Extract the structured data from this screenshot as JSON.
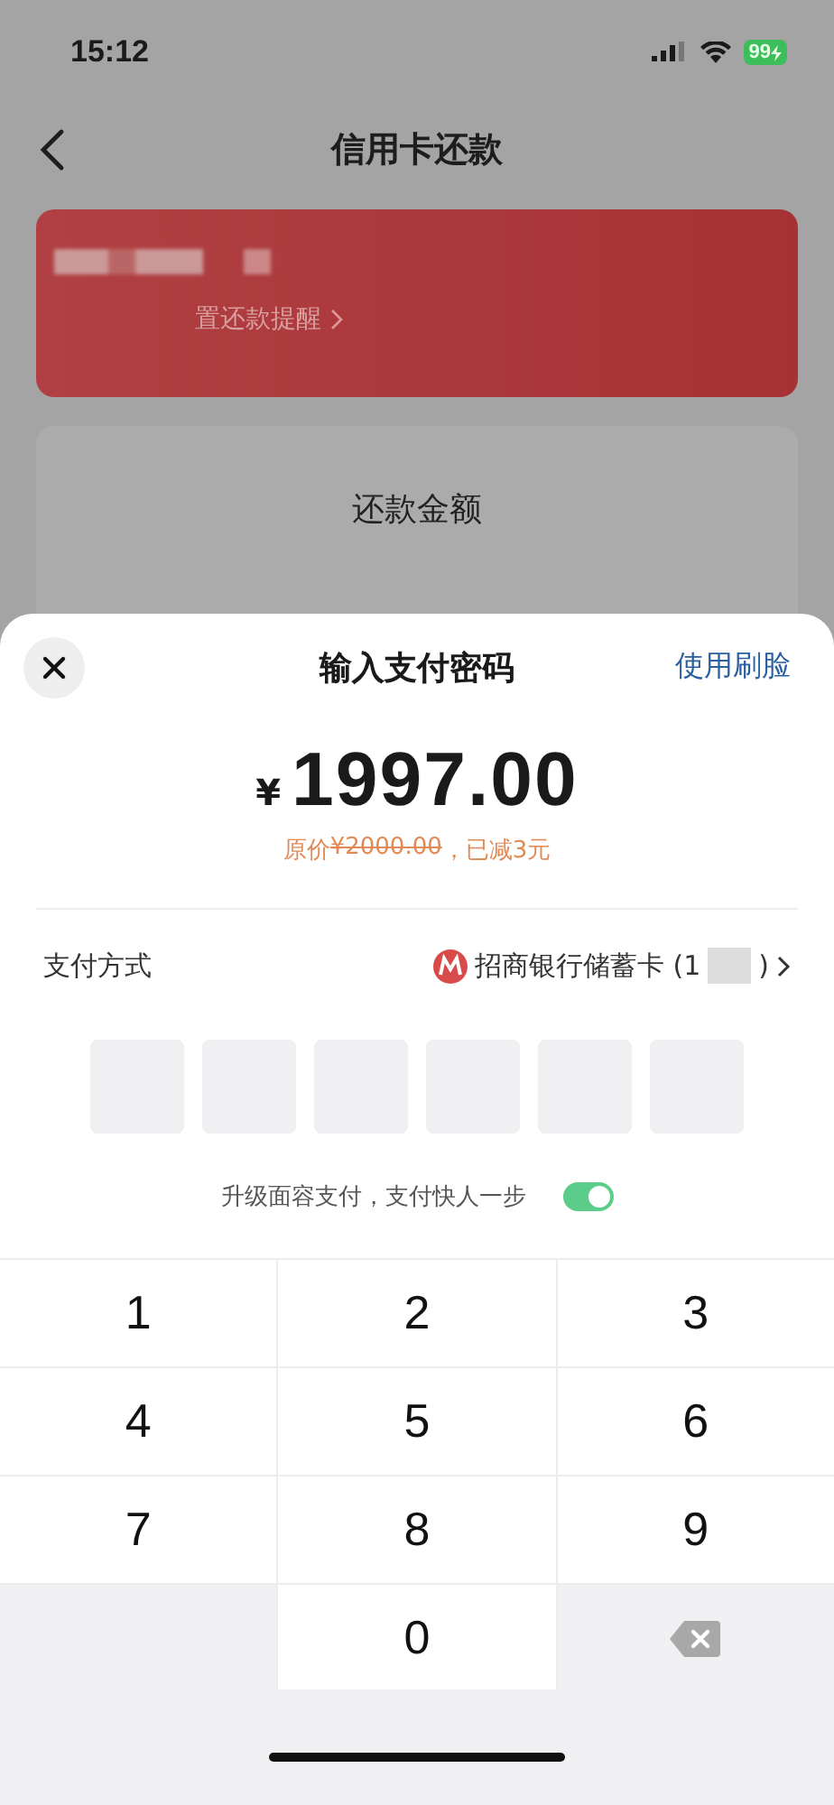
{
  "status_bar": {
    "time": "15:12",
    "battery": "99"
  },
  "nav": {
    "title": "信用卡还款"
  },
  "card": {
    "reminder_link": "置还款提醒"
  },
  "amount_card": {
    "label": "还款金额"
  },
  "sheet": {
    "title": "输入支付密码",
    "face_link": "使用刷脸",
    "currency": "¥",
    "amount": "1997.00",
    "original_label": "原价",
    "original_price": "¥2000.00",
    "discount": "，已减3元",
    "method_label": "支付方式",
    "method_value": "招商银行储蓄卡 (1",
    "method_close": ")",
    "pin_boxes": [
      {
        "filled": false
      },
      {
        "filled": false
      },
      {
        "filled": false
      },
      {
        "filled": false
      },
      {
        "filled": false
      },
      {
        "filled": false
      }
    ],
    "face_upgrade": {
      "text": "升级面容支付，支付快人一步",
      "on": true
    }
  },
  "keypad": [
    {
      "kind": "digit",
      "label": "1"
    },
    {
      "kind": "digit",
      "label": "2"
    },
    {
      "kind": "digit",
      "label": "3"
    },
    {
      "kind": "digit",
      "label": "4"
    },
    {
      "kind": "digit",
      "label": "5"
    },
    {
      "kind": "digit",
      "label": "6"
    },
    {
      "kind": "digit",
      "label": "7"
    },
    {
      "kind": "digit",
      "label": "8"
    },
    {
      "kind": "digit",
      "label": "9"
    },
    {
      "kind": "blank"
    },
    {
      "kind": "digit",
      "label": "0"
    },
    {
      "kind": "backspace"
    }
  ]
}
